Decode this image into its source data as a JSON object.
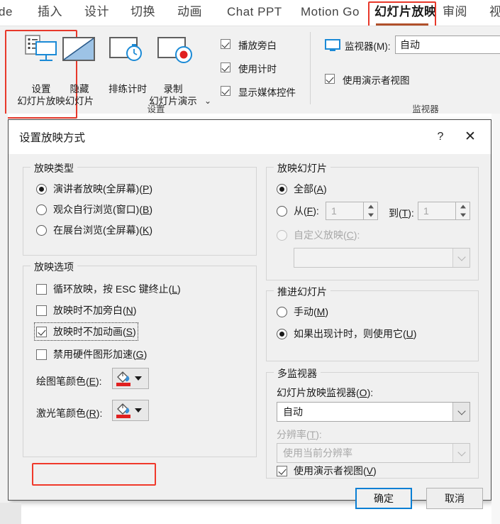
{
  "ribbon": {
    "tabs": [
      {
        "label": "de",
        "active": false
      },
      {
        "label": "插入",
        "active": false
      },
      {
        "label": "设计",
        "active": false
      },
      {
        "label": "切换",
        "active": false
      },
      {
        "label": "动画",
        "active": false
      },
      {
        "label": "Chat PPT",
        "active": false
      },
      {
        "label": "Motion Go",
        "active": false
      },
      {
        "label": "幻灯片放映",
        "active": true
      },
      {
        "label": "审阅",
        "active": false
      },
      {
        "label": "视",
        "active": false
      }
    ],
    "groups": [
      {
        "label": "设置"
      },
      {
        "label": "监视器"
      }
    ],
    "buttons": [
      {
        "line1": "设置",
        "line2": "幻灯片放映",
        "icon": "setup-slideshow-icon",
        "highlighted": true
      },
      {
        "line1": "隐藏",
        "line2": "幻灯片",
        "icon": "hide-slide-icon",
        "highlighted": false
      },
      {
        "line1": "排练计时",
        "line2": "",
        "icon": "rehearse-timings-icon",
        "highlighted": false
      },
      {
        "line1": "录制",
        "line2": "幻灯片演示",
        "icon": "record-slideshow-icon",
        "highlighted": false
      }
    ],
    "record_dropdown_caret": "⌄",
    "checkboxes": [
      {
        "label": "播放旁白",
        "checked": true
      },
      {
        "label": "使用计时",
        "checked": true
      },
      {
        "label": "显示媒体控件",
        "checked": true
      }
    ],
    "monitor": {
      "label": "监视器(M):",
      "value": "自动",
      "presenter_view": {
        "label": "使用演示者视图",
        "checked": true
      },
      "icon": "monitor-icon"
    }
  },
  "dialog": {
    "title": "设置放映方式",
    "help_icon": "?",
    "close_icon": "✕",
    "show_type": {
      "title": "放映类型",
      "options": [
        {
          "label_pre": "演讲者放映(全屏幕)(",
          "accel": "P",
          "label_post": ")",
          "checked": true
        },
        {
          "label_pre": "观众自行浏览(窗口)(",
          "accel": "B",
          "label_post": ")",
          "checked": false
        },
        {
          "label_pre": "在展台浏览(全屏幕)(",
          "accel": "K",
          "label_post": ")",
          "checked": false
        }
      ]
    },
    "show_options": {
      "title": "放映选项",
      "checkboxes": [
        {
          "label_pre": "循环放映，按 ESC 键终止(",
          "accel": "L",
          "label_post": ")",
          "checked": false,
          "highlighted": false
        },
        {
          "label_pre": "放映时不加旁白(",
          "accel": "N",
          "label_post": ")",
          "checked": false,
          "highlighted": false
        },
        {
          "label_pre": "放映时不加动画(",
          "accel": "S",
          "label_post": ")",
          "checked": true,
          "highlighted": true
        },
        {
          "label_pre": "禁用硬件图形加速(",
          "accel": "G",
          "label_post": ")",
          "checked": false,
          "highlighted": false
        }
      ],
      "pen_color": {
        "label_pre": "绘图笔颜色(",
        "accel": "E",
        "label_post": "):",
        "color": "#e02020",
        "icon": "paint-bucket-icon"
      },
      "laser_color": {
        "label_pre": "激光笔颜色(",
        "accel": "R",
        "label_post": "):",
        "color": "#e02020",
        "icon": "paint-bucket-icon"
      }
    },
    "show_slides": {
      "title": "放映幻灯片",
      "all": {
        "label_pre": "全部(",
        "accel": "A",
        "label_post": ")",
        "checked": true
      },
      "range": {
        "from_label_pre": "从(",
        "from_accel": "F",
        "from_label_post": "):",
        "from_value": "1",
        "to_label_pre": "到(",
        "to_accel": "T",
        "to_label_post": "):",
        "to_value": "1",
        "checked": false
      },
      "custom": {
        "label_pre": "自定义放映(",
        "accel": "C",
        "label_post": "):",
        "checked": false,
        "disabled": true,
        "combo_value": ""
      }
    },
    "advance_slides": {
      "title": "推进幻灯片",
      "options": [
        {
          "label_pre": "手动(",
          "accel": "M",
          "label_post": ")",
          "checked": false
        },
        {
          "label_pre": "如果出现计时，则使用它(",
          "accel": "U",
          "label_post": ")",
          "checked": true
        }
      ]
    },
    "multi_monitor": {
      "title": "多监视器",
      "monitor_label_pre": "幻灯片放映监视器(",
      "monitor_accel": "O",
      "monitor_label_post": "):",
      "monitor_value": "自动",
      "resolution_label_pre": "分辨率(",
      "resolution_accel": "T",
      "resolution_label_post": "):",
      "resolution_value": "使用当前分辨率",
      "resolution_disabled": true,
      "presenter_view": {
        "label_pre": "使用演示者视图(",
        "accel": "V",
        "label_post": ")",
        "checked": true
      }
    },
    "buttons": {
      "ok": "确定",
      "cancel": "取消"
    }
  },
  "colors": {
    "accent_red": "#e8382a",
    "tab_underline": "#b0502b",
    "primary_border": "#0a7fd4",
    "pen_red": "#e02020"
  }
}
